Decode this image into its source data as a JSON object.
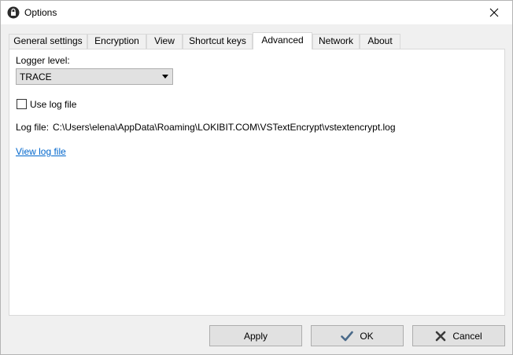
{
  "window": {
    "title": "Options",
    "icon": "padlock-icon",
    "close_icon": "close-icon"
  },
  "tabs": [
    {
      "label": "General settings",
      "active": false
    },
    {
      "label": "Encryption",
      "active": false
    },
    {
      "label": "View",
      "active": false
    },
    {
      "label": "Shortcut keys",
      "active": false
    },
    {
      "label": "Advanced",
      "active": true
    },
    {
      "label": "Network",
      "active": false
    },
    {
      "label": "About",
      "active": false
    }
  ],
  "advanced": {
    "logger_level_label": "Logger level:",
    "logger_level_value": "TRACE",
    "use_log_file_label": "Use log file",
    "use_log_file_checked": false,
    "log_file_label": "Log file:",
    "log_file_path": "C:\\Users\\elena\\AppData\\Roaming\\LOKIBIT.COM\\VSTextEncrypt\\vstextencrypt.log",
    "view_log_file_link": "View log file"
  },
  "buttons": {
    "apply": "Apply",
    "ok": "OK",
    "cancel": "Cancel"
  },
  "colors": {
    "link": "#0066cc",
    "ok_check": "#4a6a8a",
    "cancel_x": "#3a3a3a"
  }
}
